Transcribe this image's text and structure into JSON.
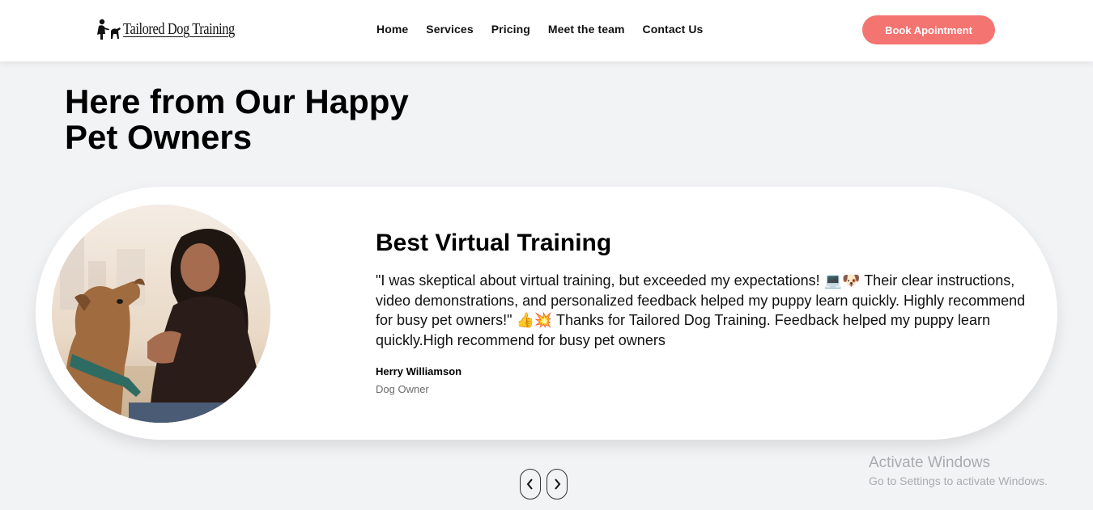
{
  "brand": {
    "name": "Tailored Dog Training",
    "logo_icon": "dog-trainer-silhouette-icon"
  },
  "nav": {
    "links": [
      "Home",
      "Services",
      "Pricing",
      "Meet the team",
      "Contact Us"
    ],
    "cta_label": "Book Apointment"
  },
  "section": {
    "heading_line1": "Here from Our Happy",
    "heading_line2": "Pet Owners"
  },
  "testimonial": {
    "title": "Best Virtual Training",
    "quote_part1": "\"I was skeptical about virtual training, but exceeded my expectations! ",
    "emoji1": "💻🐶",
    "quote_part2": " Their clear instructions, video demonstrations, and personalized feedback helped my puppy learn quickly. Highly recommend for busy pet owners!\" ",
    "emoji2": "👍💥",
    "quote_part3": " Thanks for Tailored Dog Training. Feedback helped my puppy learn quickly.High recommend for busy pet owners",
    "author": "Herry Williamson",
    "role": "Dog Owner",
    "photo_subject": "woman-petting-dog-photo"
  },
  "carousel": {
    "prev_icon": "chevron-left-icon",
    "next_icon": "chevron-right-icon"
  },
  "watermark": {
    "title": "Activate Windows",
    "subtitle": "Go to Settings to activate Windows."
  },
  "colors": {
    "accent": "#f47471",
    "background": "#f2f3f5",
    "card": "#ffffff"
  }
}
